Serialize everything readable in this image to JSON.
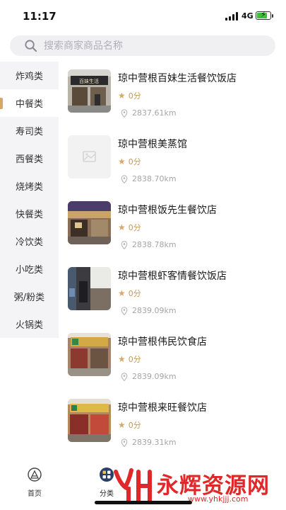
{
  "status": {
    "time": "11:17",
    "network": "4G"
  },
  "search": {
    "placeholder": "搜索商家商品名称"
  },
  "sidebar": {
    "items": [
      {
        "label": "炸鸡类",
        "active": false
      },
      {
        "label": "中餐类",
        "active": true
      },
      {
        "label": "寿司类",
        "active": false
      },
      {
        "label": "西餐类",
        "active": false
      },
      {
        "label": "烧烤类",
        "active": false
      },
      {
        "label": "快餐类",
        "active": false
      },
      {
        "label": "冷饮类",
        "active": false
      },
      {
        "label": "小吃类",
        "active": false
      },
      {
        "label": "粥/粉类",
        "active": false
      },
      {
        "label": "火锅类",
        "active": false
      }
    ]
  },
  "shops": [
    {
      "name": "琼中营根百妹生活餐饮饭店",
      "rating": "0分",
      "distance": "2837.61km",
      "image": "storefront"
    },
    {
      "name": "琼中营根美蒸馆",
      "rating": "0分",
      "distance": "2838.70km",
      "image": "placeholder"
    },
    {
      "name": "琼中营根饭先生餐饮店",
      "rating": "0分",
      "distance": "2838.78km",
      "image": "storefront"
    },
    {
      "name": "琼中营根虾客情餐饮饭店",
      "rating": "0分",
      "distance": "2839.09km",
      "image": "storefront"
    },
    {
      "name": "琼中营根伟民饮食店",
      "rating": "0分",
      "distance": "2839.09km",
      "image": "storefront"
    },
    {
      "name": "琼中营根来旺餐饮店",
      "rating": "0分",
      "distance": "2839.31km",
      "image": "storefront"
    }
  ],
  "tabbar": {
    "tabs": [
      {
        "label": "首页",
        "icon": "home-icon"
      },
      {
        "label": "分类",
        "icon": "category-icon",
        "active": true
      }
    ]
  },
  "watermark": {
    "text": "永辉资源网",
    "url": "www.yhkjjj.com"
  },
  "colors": {
    "accent": "#d6a867",
    "watermark": "#e0282a",
    "sidebar_bg": "#f4f4f6"
  }
}
